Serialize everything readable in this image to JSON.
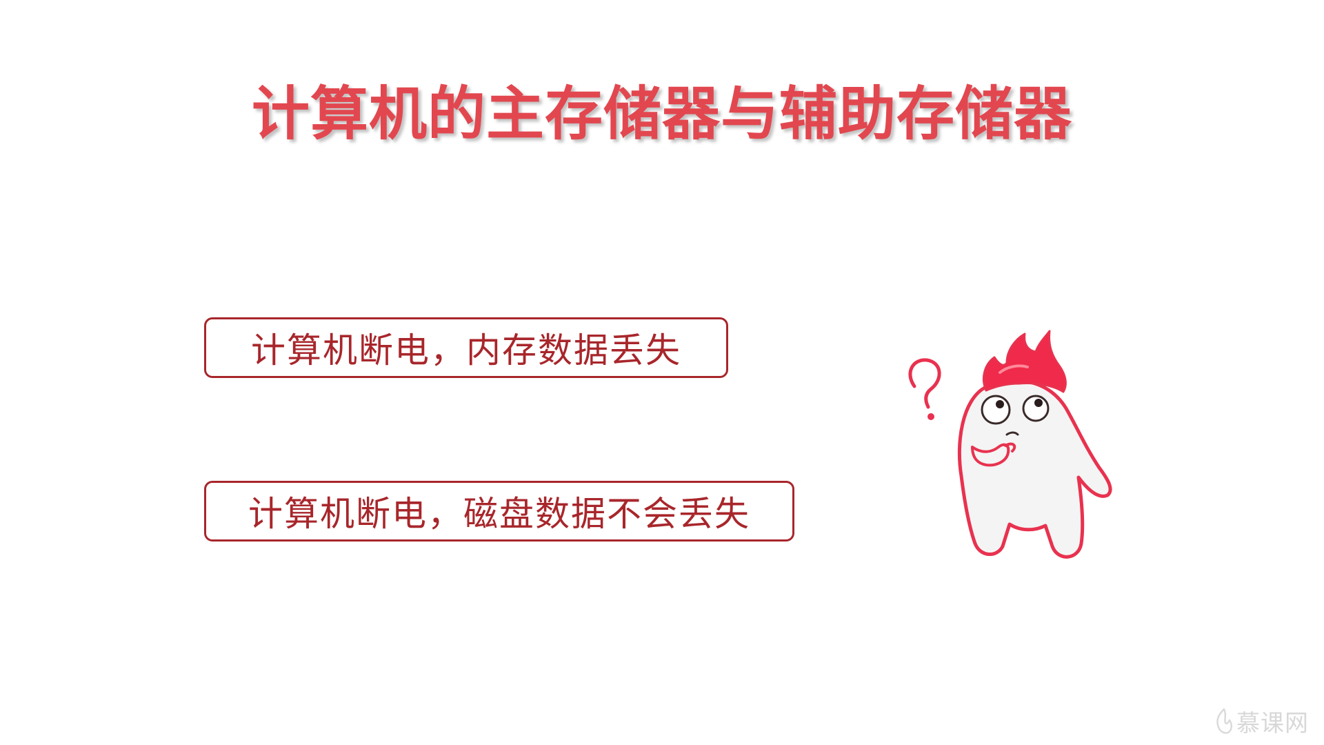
{
  "slide": {
    "title": "计算机的主存储器与辅助存储器",
    "points": [
      {
        "text": "计算机断电，内存数据丢失"
      },
      {
        "text": "计算机断电，磁盘数据不会丢失"
      }
    ]
  },
  "mascot": {
    "icon": "thinking-mascot-icon",
    "mark": "question-mark-icon"
  },
  "watermark": {
    "text": "慕课网",
    "icon": "flame-logo-icon"
  },
  "colors": {
    "title": "#e2474f",
    "box_border": "#a8262b",
    "mascot_hair": "#ef2a4a",
    "background": "#ffffff"
  }
}
